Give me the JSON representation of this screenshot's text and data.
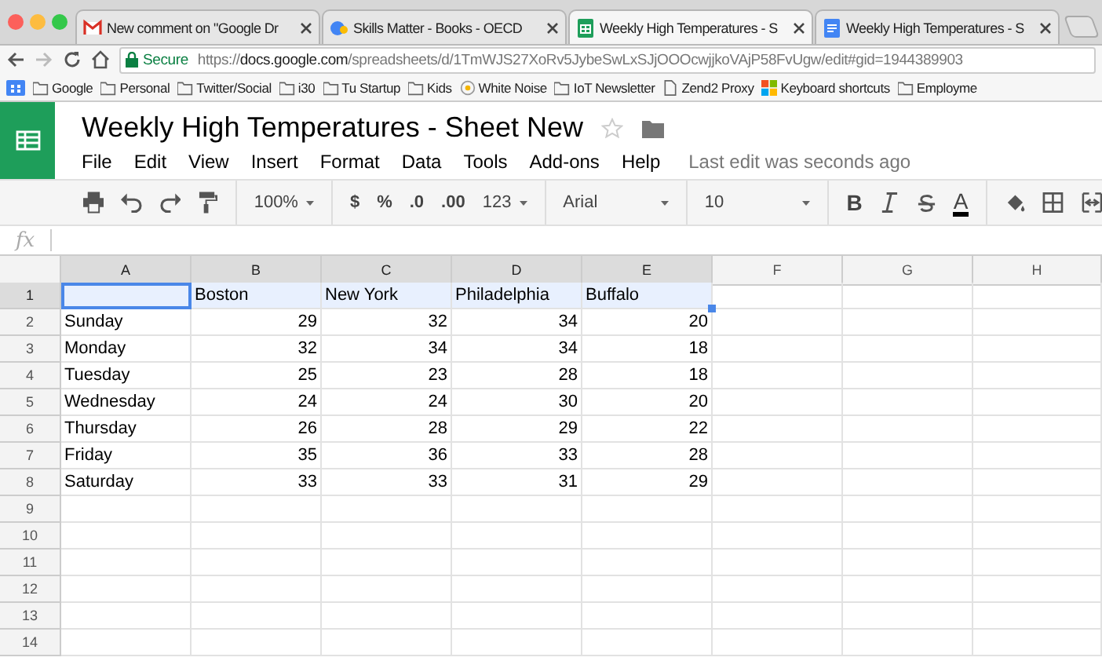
{
  "browser": {
    "tabs": [
      {
        "title": "New comment on \"Google Dr",
        "kind": "mail",
        "selected": false
      },
      {
        "title": "Skills Matter - Books - OECD",
        "kind": "site",
        "selected": false
      },
      {
        "title": "Weekly High Temperatures - S",
        "kind": "sheet",
        "selected": true
      },
      {
        "title": "Weekly High Temperatures - S",
        "kind": "doc",
        "selected": false
      }
    ],
    "address": {
      "secure_label": "Secure",
      "scheme": "https://",
      "host": "docs.google.com",
      "path": "/spreadsheets/d/1TmWJS27XoRv5JybeSwLxSJjOOOcwjjkoVAjP58FvUgw/edit#gid=1944389903"
    },
    "bookmarks": [
      {
        "kind": "apps"
      },
      {
        "kind": "folder",
        "label": "Google"
      },
      {
        "kind": "folder",
        "label": "Personal"
      },
      {
        "kind": "folder",
        "label": "Twitter/Social"
      },
      {
        "kind": "folder",
        "label": "i30"
      },
      {
        "kind": "folder",
        "label": "Tu Startup"
      },
      {
        "kind": "folder",
        "label": "Kids"
      },
      {
        "kind": "site",
        "label": "White Noise"
      },
      {
        "kind": "folder",
        "label": "IoT Newsletter"
      },
      {
        "kind": "page",
        "label": "Zend2 Proxy"
      },
      {
        "kind": "tiles",
        "label": "Keyboard shortcuts"
      },
      {
        "kind": "folder",
        "label": "Employme"
      }
    ]
  },
  "sheet": {
    "title": "Weekly High Temperatures - Sheet New",
    "menus": [
      "File",
      "Edit",
      "View",
      "Insert",
      "Format",
      "Data",
      "Tools",
      "Add-ons",
      "Help"
    ],
    "last_edit": "Last edit was seconds ago",
    "toolbar": [
      {
        "kind": "print"
      },
      {
        "kind": "undo"
      },
      {
        "kind": "redo"
      },
      {
        "kind": "paint-format"
      },
      {
        "kind": "sep"
      },
      {
        "kind": "dropdown",
        "label": "100%"
      },
      {
        "kind": "sep"
      },
      {
        "kind": "text",
        "label": "$"
      },
      {
        "kind": "text",
        "label": "%"
      },
      {
        "kind": "text",
        "label": ".0"
      },
      {
        "kind": "text",
        "label": ".00"
      },
      {
        "kind": "dropdown",
        "label": "123"
      },
      {
        "kind": "sep"
      },
      {
        "kind": "dropdown",
        "label": "Arial",
        "wide": true
      },
      {
        "kind": "sep"
      },
      {
        "kind": "dropdown",
        "label": "10",
        "wide": true
      },
      {
        "kind": "sep"
      },
      {
        "kind": "bold",
        "label": "B"
      },
      {
        "kind": "italic"
      },
      {
        "kind": "strike"
      },
      {
        "kind": "text-color",
        "label": "A"
      },
      {
        "kind": "sep"
      },
      {
        "kind": "fill"
      },
      {
        "kind": "borders"
      },
      {
        "kind": "merge"
      }
    ],
    "formula_label": "fx"
  },
  "grid": {
    "columns": [
      {
        "label": "A",
        "selected": true
      },
      {
        "label": "B",
        "selected": true
      },
      {
        "label": "C",
        "selected": true
      },
      {
        "label": "D",
        "selected": true
      },
      {
        "label": "E",
        "selected": true
      },
      {
        "label": "F",
        "selected": false
      },
      {
        "label": "G",
        "selected": false
      },
      {
        "label": "H",
        "selected": false
      }
    ],
    "rows": [
      {
        "number": "1",
        "selected": true,
        "kind": "header",
        "cells": [
          "",
          "Boston",
          "New York",
          "Philadelphia",
          "Buffalo"
        ]
      },
      {
        "number": "2",
        "selected": false,
        "kind": "data",
        "cells": [
          "Sunday",
          "29",
          "32",
          "34",
          "20"
        ]
      },
      {
        "number": "3",
        "selected": false,
        "kind": "data",
        "cells": [
          "Monday",
          "32",
          "34",
          "34",
          "18"
        ]
      },
      {
        "number": "4",
        "selected": false,
        "kind": "data",
        "cells": [
          "Tuesday",
          "25",
          "23",
          "28",
          "18"
        ]
      },
      {
        "number": "5",
        "selected": false,
        "kind": "data",
        "cells": [
          "Wednesday",
          "24",
          "24",
          "30",
          "20"
        ]
      },
      {
        "number": "6",
        "selected": false,
        "kind": "data",
        "cells": [
          "Thursday",
          "26",
          "28",
          "29",
          "22"
        ]
      },
      {
        "number": "7",
        "selected": false,
        "kind": "data",
        "cells": [
          "Friday",
          "35",
          "36",
          "33",
          "28"
        ]
      },
      {
        "number": "8",
        "selected": false,
        "kind": "data",
        "cells": [
          "Saturday",
          "33",
          "33",
          "31",
          "29"
        ]
      },
      {
        "number": "9",
        "selected": false,
        "kind": "data",
        "cells": []
      },
      {
        "number": "10",
        "selected": false,
        "kind": "data",
        "cells": []
      },
      {
        "number": "11",
        "selected": false,
        "kind": "data",
        "cells": []
      },
      {
        "number": "12",
        "selected": false,
        "kind": "data",
        "cells": []
      },
      {
        "number": "13",
        "selected": false,
        "kind": "data",
        "cells": []
      },
      {
        "number": "14",
        "selected": false,
        "kind": "data",
        "cells": []
      }
    ]
  }
}
